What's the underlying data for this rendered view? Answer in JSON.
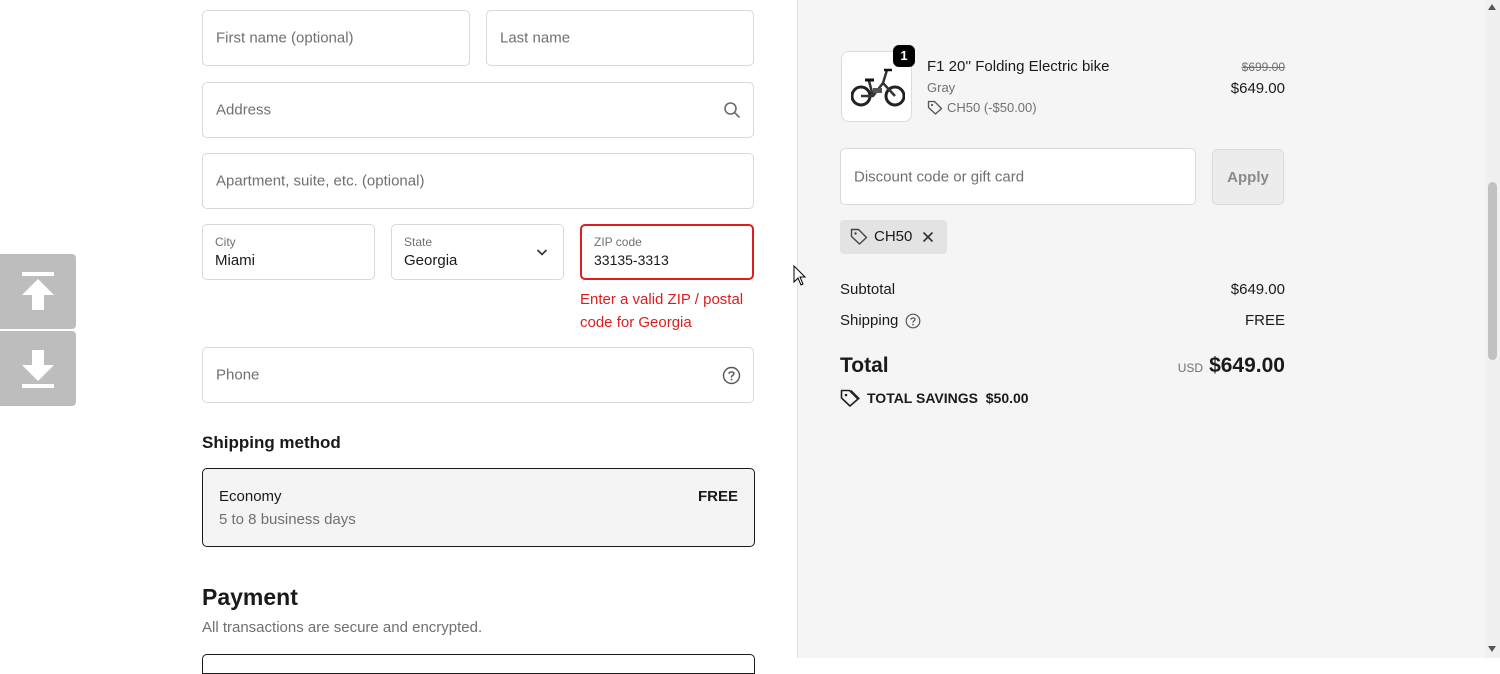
{
  "form": {
    "first_name_placeholder": "First name (optional)",
    "last_name_placeholder": "Last name",
    "address_placeholder": "Address",
    "apartment_placeholder": "Apartment, suite, etc. (optional)",
    "city_label": "City",
    "city_value": "Miami",
    "state_label": "State",
    "state_value": "Georgia",
    "zip_label": "ZIP code",
    "zip_value": "33135-3313",
    "zip_error_line1": "Enter a valid ZIP / postal",
    "zip_error_line2": "code for Georgia",
    "phone_placeholder": "Phone"
  },
  "shipping": {
    "heading": "Shipping method",
    "option_name": "Economy",
    "option_desc": "5 to 8 business days",
    "option_price": "FREE"
  },
  "payment": {
    "heading": "Payment",
    "subtitle": "All transactions are secure and encrypted."
  },
  "order": {
    "product_name": "F1 20'' Folding Electric bike",
    "product_variant": "Gray",
    "product_discount": "CH50 (-$50.00)",
    "quantity_badge": "1",
    "original_price": "$699.00",
    "price": "$649.00",
    "discount_placeholder": "Discount code or gift card",
    "apply_label": "Apply",
    "applied_code": "CH50",
    "subtotal_label": "Subtotal",
    "subtotal_value": "$649.00",
    "shipping_label": "Shipping",
    "shipping_value": "FREE",
    "total_label": "Total",
    "total_currency": "USD",
    "total_value": "$649.00",
    "savings_label": "TOTAL SAVINGS",
    "savings_value": "$50.00"
  },
  "colors": {
    "error": "#dd1d1d",
    "border": "#d9d9d9",
    "summary_bg": "#f5f5f5",
    "muted": "#707070"
  },
  "icons": [
    "search-icon",
    "chevron-down-icon",
    "help-circle-icon",
    "tag-icon",
    "close-icon",
    "arrow-up-icon",
    "arrow-down-icon",
    "bike-thumbnail"
  ]
}
